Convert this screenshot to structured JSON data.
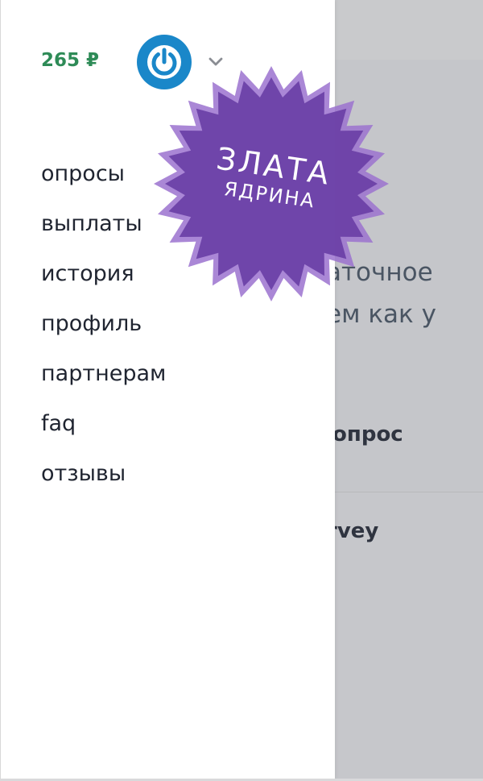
{
  "background": {
    "line1": "аточное",
    "line2": "ем как у",
    "line3": "опрос",
    "line4": "rvey"
  },
  "drawer": {
    "balance": "265 ₽",
    "avatar_icon": "power-logo-icon",
    "chevron_icon": "chevron-down-icon",
    "menu": [
      {
        "label": "опросы"
      },
      {
        "label": "выплаты"
      },
      {
        "label": "история"
      },
      {
        "label": "профиль"
      },
      {
        "label": "партнерам"
      },
      {
        "label": "faq"
      },
      {
        "label": "отзывы"
      }
    ]
  },
  "watermark": {
    "line1": "ЗЛАТА",
    "line2": "ЯДРИНА",
    "color": "#6a3fa6"
  },
  "colors": {
    "balance": "#2e8b57",
    "avatar": "#1a87c9",
    "menu_text": "#1f2430"
  }
}
